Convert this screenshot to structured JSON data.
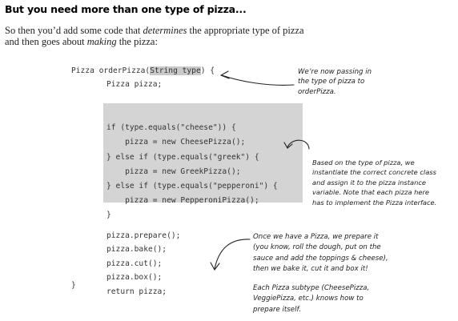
{
  "heading": "But you need more than one type of pizza...",
  "intro": {
    "line1_pre": "So then you’d add some code that ",
    "line1_em": "determines",
    "line1_post": " the appropriate type of pizza",
    "line2_pre": "and then goes about ",
    "line2_em": "making",
    "line2_post": " the pizza:"
  },
  "code": {
    "sig_pre": "Pizza orderPizza(",
    "sig_param": "String type",
    "sig_post": ") {",
    "decl": "Pizza pizza;",
    "if_lines": [
      "if (type.equals(\"cheese\")) {",
      "    pizza = new CheesePizza();",
      "} else if (type.equals(\"greek\") {",
      "    pizza = new GreekPizza();",
      "} else if (type.equals(\"pepperoni\") {",
      "    pizza = new PepperoniPizza();",
      "}"
    ],
    "calls": [
      "pizza.prepare();",
      "pizza.bake();",
      "pizza.cut();",
      "pizza.box();",
      "return pizza;"
    ],
    "close": "}"
  },
  "notes": {
    "passing": [
      "We’re now passing in",
      "the type of pizza to",
      "orderPizza."
    ],
    "instantiate": [
      "Based on the type of pizza, we",
      "instantiate the correct concrete class",
      "and assign it to the pizza instance",
      "variable. Note that each pizza here",
      "has to implement the Pizza interface."
    ],
    "prepare": [
      "Once we have a Pizza, we prepare it",
      "(you know, roll the dough, put on the",
      "sauce and add the toppings & cheese),",
      "then we bake it, cut it and box it!"
    ],
    "subtypes": [
      "Each Pizza subtype (CheesePizza,",
      "VeggiePizza, etc.) knows how to",
      "prepare itself."
    ]
  }
}
